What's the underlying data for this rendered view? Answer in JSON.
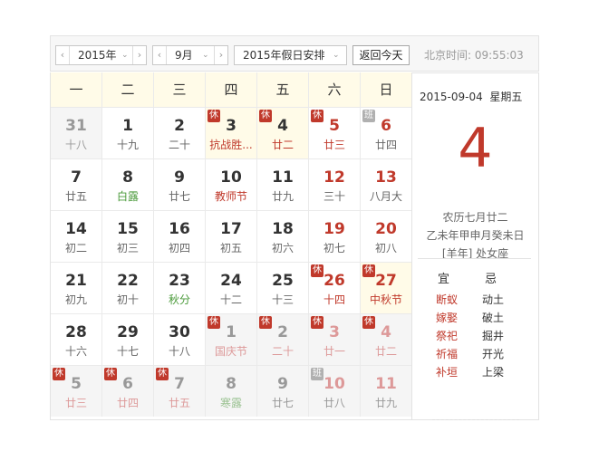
{
  "toolbar": {
    "year": "2015年",
    "month": "9月",
    "holiday": "2015年假日安排",
    "today_button": "返回今天",
    "clock_label": "北京时间:",
    "clock_time": "09:55:03"
  },
  "weekdays": [
    "一",
    "二",
    "三",
    "四",
    "五",
    "六",
    "日"
  ],
  "days": [
    {
      "n": "31",
      "l": "十八",
      "type": "other"
    },
    {
      "n": "1",
      "l": "十九"
    },
    {
      "n": "2",
      "l": "二十"
    },
    {
      "n": "3",
      "l": "抗战胜...",
      "badge": "休",
      "type": "holiday",
      "lcolor": "red"
    },
    {
      "n": "4",
      "l": "廿二",
      "badge": "休",
      "type": "holiday",
      "lcolor": "red"
    },
    {
      "n": "5",
      "l": "廿三",
      "badge": "休",
      "ncolor": "red",
      "lcolor": "red"
    },
    {
      "n": "6",
      "l": "廿四",
      "badge": "班",
      "ncolor": "red"
    },
    {
      "n": "7",
      "l": "廿五"
    },
    {
      "n": "8",
      "l": "白露",
      "lcolor": "green"
    },
    {
      "n": "9",
      "l": "廿七"
    },
    {
      "n": "10",
      "l": "教师节",
      "lcolor": "red"
    },
    {
      "n": "11",
      "l": "廿九"
    },
    {
      "n": "12",
      "l": "三十",
      "ncolor": "red"
    },
    {
      "n": "13",
      "l": "八月大",
      "ncolor": "red"
    },
    {
      "n": "14",
      "l": "初二"
    },
    {
      "n": "15",
      "l": "初三"
    },
    {
      "n": "16",
      "l": "初四"
    },
    {
      "n": "17",
      "l": "初五"
    },
    {
      "n": "18",
      "l": "初六"
    },
    {
      "n": "19",
      "l": "初七",
      "ncolor": "red"
    },
    {
      "n": "20",
      "l": "初八",
      "ncolor": "red"
    },
    {
      "n": "21",
      "l": "初九"
    },
    {
      "n": "22",
      "l": "初十"
    },
    {
      "n": "23",
      "l": "秋分",
      "lcolor": "green"
    },
    {
      "n": "24",
      "l": "十二"
    },
    {
      "n": "25",
      "l": "十三"
    },
    {
      "n": "26",
      "l": "十四",
      "badge": "休",
      "ncolor": "red",
      "lcolor": "red"
    },
    {
      "n": "27",
      "l": "中秋节",
      "badge": "休",
      "type": "holiday",
      "ncolor": "red",
      "lcolor": "red"
    },
    {
      "n": "28",
      "l": "十六"
    },
    {
      "n": "29",
      "l": "十七"
    },
    {
      "n": "30",
      "l": "十八"
    },
    {
      "n": "1",
      "l": "国庆节",
      "badge": "休",
      "type": "other",
      "lcolor": "fadered"
    },
    {
      "n": "2",
      "l": "二十",
      "badge": "休",
      "type": "other",
      "lcolor": "fadered"
    },
    {
      "n": "3",
      "l": "廿一",
      "badge": "休",
      "type": "other",
      "ncolor": "fadered",
      "lcolor": "fadered"
    },
    {
      "n": "4",
      "l": "廿二",
      "badge": "休",
      "type": "other",
      "ncolor": "fadered",
      "lcolor": "fadered"
    },
    {
      "n": "5",
      "l": "廿三",
      "badge": "休",
      "type": "other",
      "lcolor": "fadered"
    },
    {
      "n": "6",
      "l": "廿四",
      "badge": "休",
      "type": "other",
      "lcolor": "fadered"
    },
    {
      "n": "7",
      "l": "廿五",
      "badge": "休",
      "type": "other",
      "lcolor": "fadered"
    },
    {
      "n": "8",
      "l": "寒露",
      "type": "other",
      "lcolor": "fadegreen"
    },
    {
      "n": "9",
      "l": "廿七",
      "type": "other"
    },
    {
      "n": "10",
      "l": "廿八",
      "badge": "班",
      "type": "other",
      "ncolor": "fadered"
    },
    {
      "n": "11",
      "l": "廿九",
      "type": "other",
      "ncolor": "fadered"
    }
  ],
  "side": {
    "date": "2015-09-04",
    "weekday": "星期五",
    "day": "4",
    "lunar": "农历七月廿二",
    "ganzhi": "乙未年甲申月癸未日",
    "zodiac": "[羊年] 处女座",
    "yi_label": "宜",
    "ji_label": "忌",
    "yi": [
      "断蚁",
      "嫁娶",
      "祭祀",
      "祈福",
      "补垣"
    ],
    "ji": [
      "动土",
      "破土",
      "掘井",
      "开光",
      "上梁"
    ]
  },
  "colors": {
    "red": "#c0392b",
    "green": "#4a9a3a",
    "rest_badge": "#c0392b",
    "work_badge": "#b0b0b0"
  }
}
